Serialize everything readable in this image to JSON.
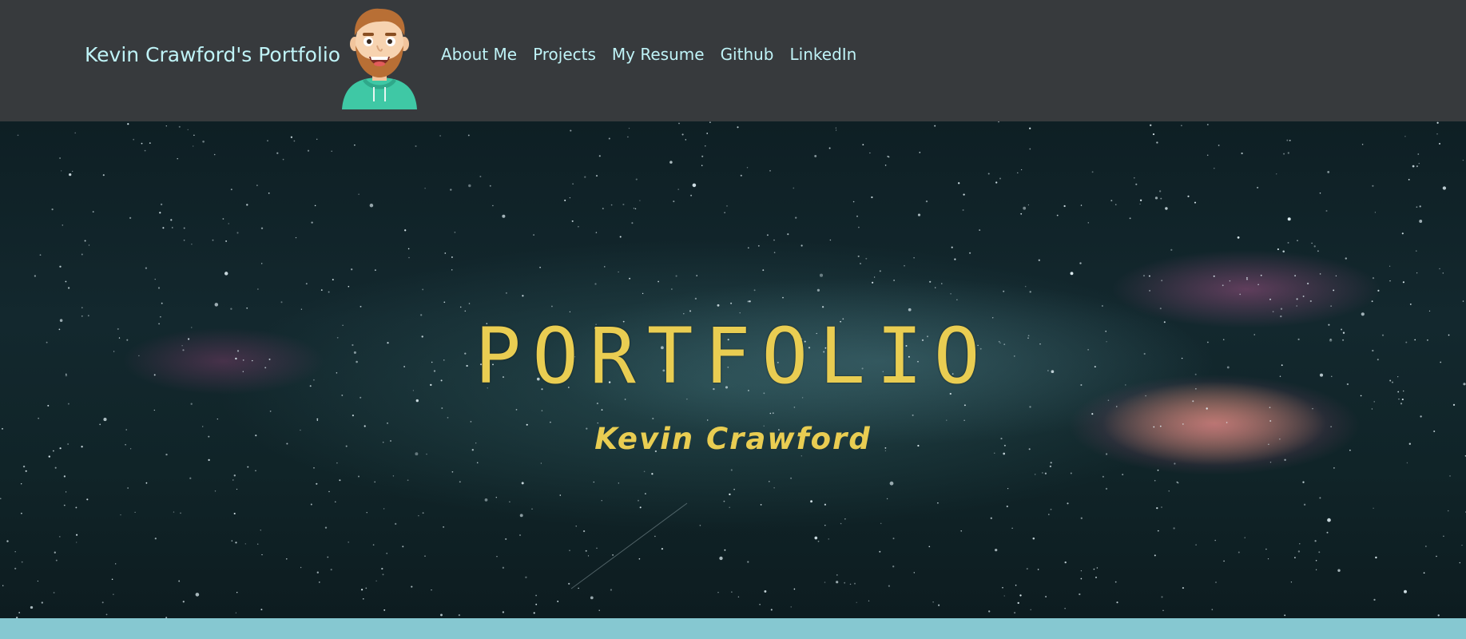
{
  "navbar": {
    "brand": "Kevin Crawford's Portfolio",
    "links": [
      {
        "label": "About Me"
      },
      {
        "label": "Projects"
      },
      {
        "label": "My Resume"
      },
      {
        "label": "Github"
      },
      {
        "label": "LinkedIn"
      }
    ]
  },
  "hero": {
    "title": "PORTFOLIO",
    "subtitle": "Kevin Crawford"
  },
  "colors": {
    "navbar_bg": "#373a3d",
    "link_color": "#bff3f7",
    "hero_text": "#e9cd52",
    "footer_band": "#86c8d1",
    "avatar_hoodie": "#3fc8a5",
    "avatar_hair": "#b86f35"
  }
}
